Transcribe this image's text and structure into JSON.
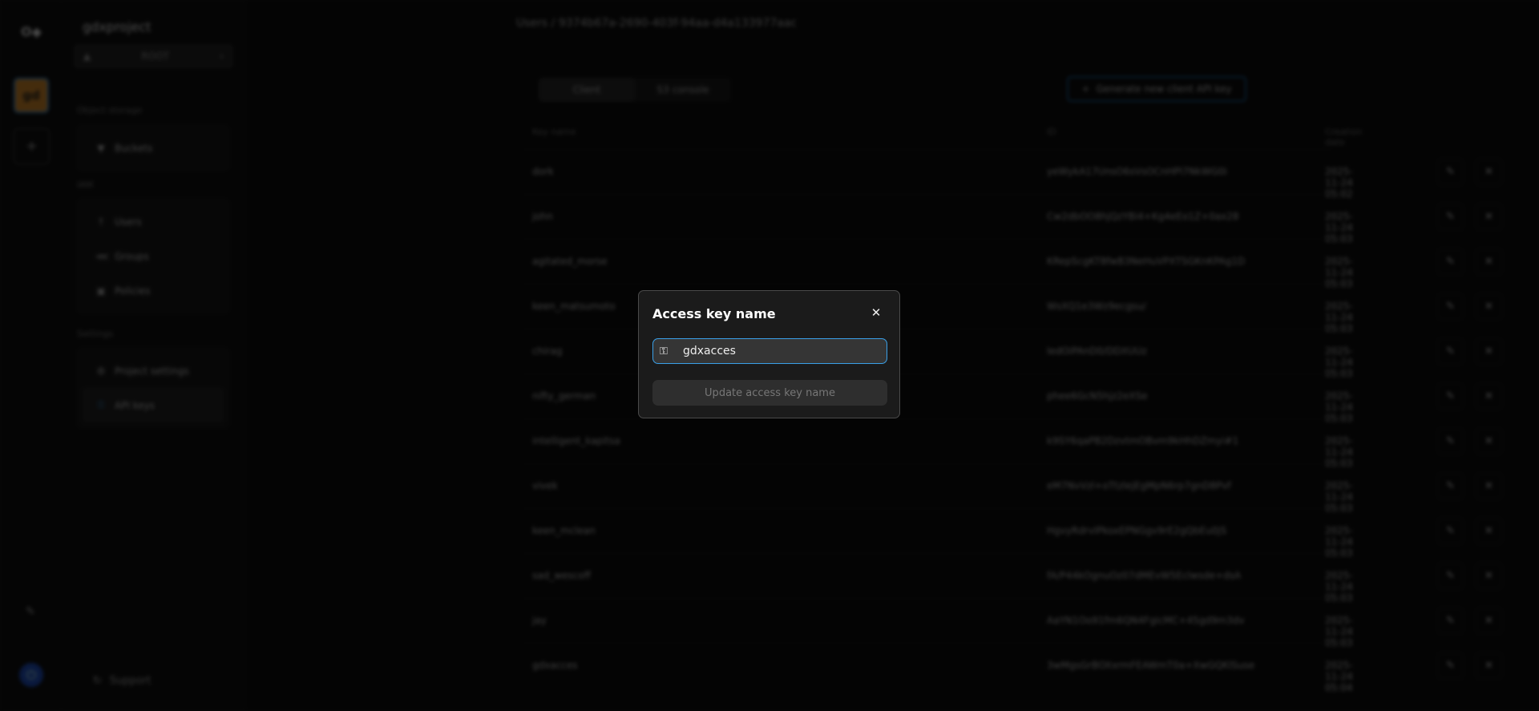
{
  "rail": {
    "logo": "O◆",
    "project_initials": "gd",
    "add": "+"
  },
  "sidebar": {
    "project": "gdxproject",
    "bucket_select": "ROOT",
    "sections": [
      {
        "title": "Object storage",
        "items": [
          {
            "label": "Buckets",
            "icon": "bucket-icon"
          }
        ]
      },
      {
        "title": "IAM",
        "items": [
          {
            "label": "Users",
            "icon": "user-icon"
          },
          {
            "label": "Groups",
            "icon": "group-icon"
          },
          {
            "label": "Policies",
            "icon": "policy-icon"
          }
        ]
      },
      {
        "title": "Settings",
        "items": [
          {
            "label": "Project settings",
            "icon": "gear-icon"
          },
          {
            "label": "API keys",
            "icon": "key-icon",
            "active": true
          }
        ]
      }
    ],
    "support": "Support"
  },
  "main": {
    "breadcrumb": {
      "parent": "Users",
      "sep": "/",
      "current": "9374b67a-2690-403f-94aa-d4a133977aac"
    },
    "tabs": [
      {
        "label": "Client",
        "active": true
      },
      {
        "label": "S3 console"
      }
    ],
    "generate_button": "Generate new client API key",
    "columns": [
      "Key name",
      "ID",
      "Creation date"
    ],
    "rows": [
      {
        "name": "dork",
        "id": "yeWykA17UnsO6sVsOCnHPl7NkWG0i",
        "date": "2025-11-24 05:02"
      },
      {
        "name": "john",
        "id": "Cw2dbOO8hjQzYBi4+Kg4eEo1Z+0ax28",
        "date": "2025-11-24 05:03"
      },
      {
        "name": "agitated_morse",
        "id": "KRepScgKT8fwB3NeHuVPXTSGKnKPAg1D",
        "date": "2025-11-24 05:03"
      },
      {
        "name": "keen_matsumoto",
        "id": "WsXQ1e3Wz9ecgsu/",
        "date": "2025-11-24 05:03"
      },
      {
        "name": "chirag",
        "id": "ledOiPAnD0/DDXUUz",
        "date": "2025-11-24 05:03"
      },
      {
        "name": "nifty_german",
        "id": "phee6GcN5hjz2eXSe",
        "date": "2025-11-24 05:03"
      },
      {
        "name": "intelligent_kapitsa",
        "id": "k9SY6qaPB2DzvtmOBvm9kHhDZmyi#1",
        "date": "2025-11-24 05:03"
      },
      {
        "name": "vivek",
        "id": "eM7NvVzl+oTtzlejEgMpN6rp7gnD8Pvf",
        "date": "2025-11-24 05:03"
      },
      {
        "name": "keen_mclean",
        "id": "HgvyRdrvIPkoxEPNGgv9rE2gQbEu0jS",
        "date": "2025-11-24 05:03"
      },
      {
        "name": "sad_wescoff",
        "id": "fA/P44kOgnuOz07dMEvW5Eclwsde+dsA",
        "date": "2025-11-24 05:03"
      },
      {
        "name": "jay",
        "id": "AaYN1Oo91fm6QN4FgicMC+45gd9m3dv",
        "date": "2025-11-24 05:03"
      },
      {
        "name": "gdxacces",
        "id": "3wMgsGrBOXxrmFEAWmT0a+XwGQKlSuse",
        "date": "2025-11-24 05:04"
      }
    ]
  },
  "modal": {
    "title": "Access key name",
    "input_value": "gdxacces",
    "submit": "Update access key name",
    "accent": "#3aa0e8"
  }
}
